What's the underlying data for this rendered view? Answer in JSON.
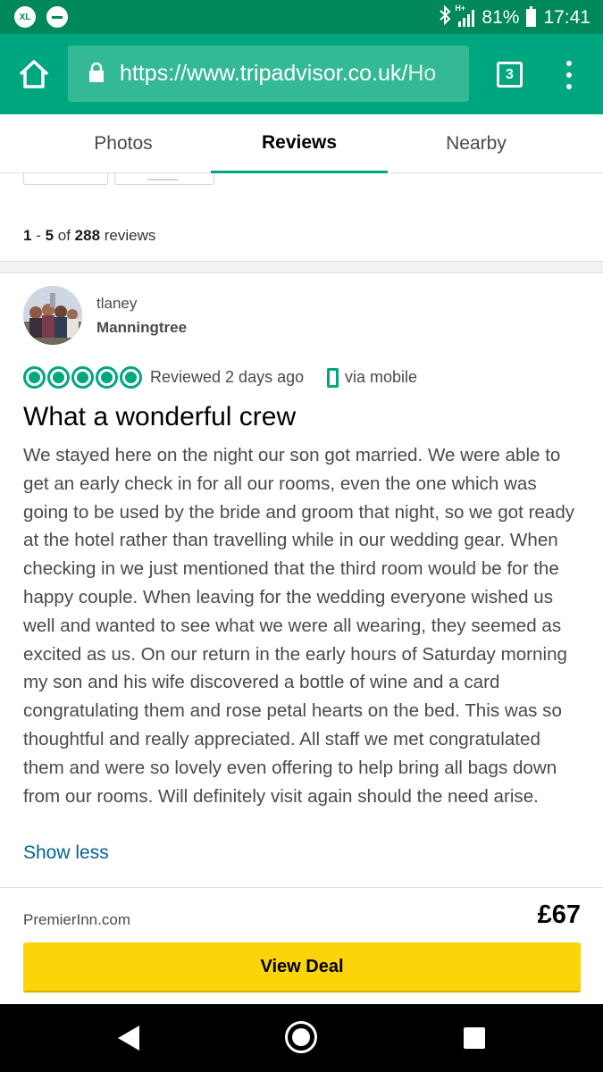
{
  "status_bar": {
    "xl_badge": "XL",
    "network": "H+",
    "battery": "81%",
    "time": "17:41",
    "icons": [
      "xl-icon",
      "dnd-icon",
      "bluetooth-icon",
      "signal-icon",
      "battery-icon"
    ]
  },
  "browser": {
    "url_main": "https://www.tripadvisor.co.uk/",
    "url_tail": "Ho",
    "tab_count": "3"
  },
  "tabs": {
    "photos": "Photos",
    "reviews": "Reviews",
    "nearby": "Nearby",
    "active": "Reviews"
  },
  "review_count": {
    "range_start": "1",
    "sep": " - ",
    "range_end": "5",
    "of": " of ",
    "total": "288",
    "suffix": " reviews"
  },
  "review": {
    "username": "tlaney",
    "location": "Manningtree",
    "rating": 5,
    "reviewed": "Reviewed 2 days ago",
    "via": "via mobile",
    "title": "What a wonderful crew",
    "body": "We stayed here on the night our son got married. We were able to get an early check in for all our rooms, even the one which was going to be used by the bride and groom that night, so we got ready at the hotel rather than travelling while in our wedding gear. When checking in we just mentioned that the third room would be for the happy couple. When leaving for the wedding everyone wished us well and wanted to see what we were all wearing, they seemed as excited as us. On our return in the early hours of Saturday morning my son and his wife discovered a bottle of wine and a card congratulating them and rose petal hearts on the bed. This was so thoughtful and really appreciated. All staff we met congratulated them and were so lovely even offering to help bring all bags down from our rooms. Will definitely visit again should the need arise.",
    "show_less": "Show less"
  },
  "deal": {
    "provider": "PremierInn.com",
    "price": "£67",
    "button": "View Deal"
  },
  "colors": {
    "brand_green": "#00a680",
    "status_green": "#00875a",
    "link_blue": "#00629b",
    "deal_yellow": "#fcd40a"
  }
}
